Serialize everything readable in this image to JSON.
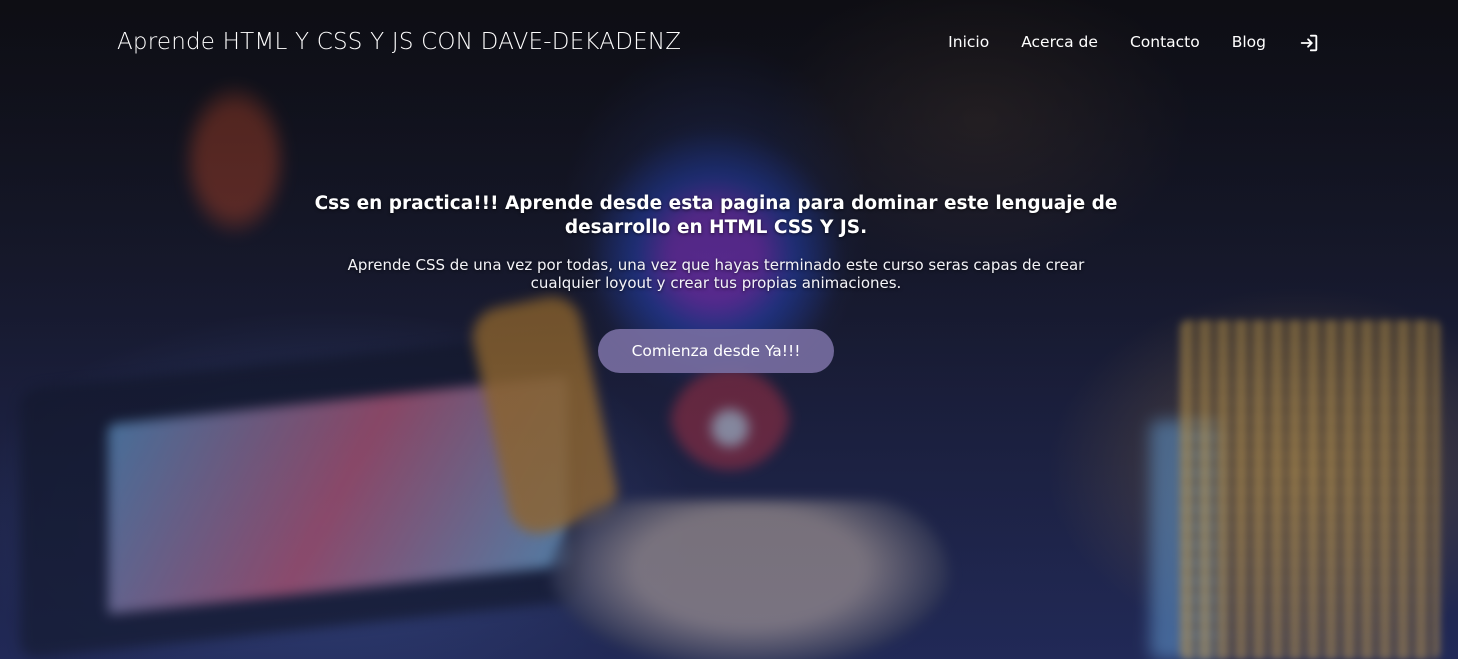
{
  "header": {
    "site_title": "Aprende HTML Y CSS Y JS CON DAVE-DEKADENZ",
    "nav": {
      "items": [
        {
          "label": "Inicio"
        },
        {
          "label": "Acerca de"
        },
        {
          "label": "Contacto"
        },
        {
          "label": "Blog"
        }
      ],
      "login_icon": "login-icon"
    }
  },
  "hero": {
    "title": "Css en practica!!! Aprende desde esta pagina para dominar este lenguaje de desarrollo en HTML CSS Y JS.",
    "text": "Aprende CSS de una vez por todas, una vez que hayas terminado este curso seras capas de crear cualquier loyout y crear tus propias animaciones.",
    "cta_label": "Comienza desde Ya!!!"
  },
  "colors": {
    "cta_background": "#766ca0",
    "text": "#ffffff"
  }
}
